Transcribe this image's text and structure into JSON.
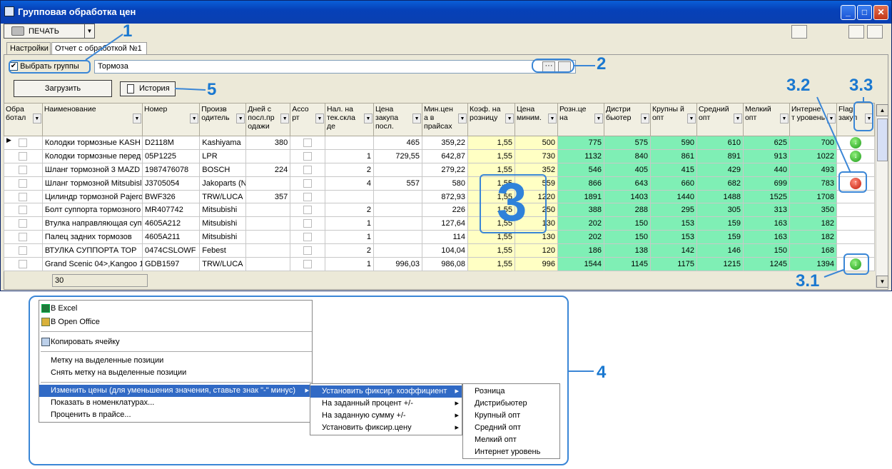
{
  "window": {
    "title": "Групповая обработка цен"
  },
  "toolbar": {
    "print_label": "ПЕЧАТЬ"
  },
  "tabs": [
    {
      "label": "Настройки"
    },
    {
      "label": "Отчет с обработкой №1"
    }
  ],
  "filter": {
    "select_groups_label": "Выбрать группы",
    "groups_value": "Тормоза",
    "dots": "···"
  },
  "buttons": {
    "load": "Загрузить",
    "history": "История"
  },
  "columns": [
    "Обра ботал",
    "Наименование",
    "Номер",
    "Произв одитель",
    "Дней с посл.пр одажи",
    "Ассо рт",
    "Нал. на тек.скла де",
    "Цена закупа посл.",
    "Мин.цен а в прайсах",
    "Коэф. на розницу",
    "Цена миним.",
    "Розн.це на",
    "Дистри бьютер",
    "Крупны й опт",
    "Средний опт",
    "Мелкий опт",
    "Интерне т уровень",
    "Flag закуп"
  ],
  "rows": [
    [
      "",
      "Колодки тормозные KASH",
      "D2118M",
      "Kashiyama",
      "380",
      "",
      "",
      "465",
      "359,22",
      "1,55",
      "500",
      "775",
      "575",
      "590",
      "610",
      "625",
      "700",
      "down"
    ],
    [
      "",
      "Колодки тормозные перед",
      "05P1225",
      "LPR",
      "",
      "",
      "1",
      "729,55",
      "642,87",
      "1,55",
      "730",
      "1132",
      "840",
      "861",
      "891",
      "913",
      "1022",
      "down"
    ],
    [
      "",
      "Шланг тормозной 3 MAZD",
      "1987476078",
      "BOSCH",
      "224",
      "",
      "2",
      "",
      "279,22",
      "1,55",
      "352",
      "546",
      "405",
      "415",
      "429",
      "440",
      "493",
      ""
    ],
    [
      "",
      "Шланг тормозной Mitsubisl",
      "J3705054",
      "Jakoparts (N",
      "",
      "",
      "4",
      "557",
      "580",
      "1,55",
      "559",
      "866",
      "643",
      "660",
      "682",
      "699",
      "783",
      "up"
    ],
    [
      "",
      "Цилиндр тормозной Pajero",
      "BWF326",
      "TRW/LUCA",
      "357",
      "",
      "",
      "",
      "872,93",
      "1,55",
      "1220",
      "1891",
      "1403",
      "1440",
      "1488",
      "1525",
      "1708",
      ""
    ],
    [
      "",
      "Болт суппорта тормозного",
      "MR407742",
      "Mitsubishi",
      "",
      "",
      "2",
      "",
      "226",
      "1,55",
      "250",
      "388",
      "288",
      "295",
      "305",
      "313",
      "350",
      ""
    ],
    [
      "",
      "Втулка направляющая суп",
      "4605A212",
      "Mitsubishi",
      "",
      "",
      "1",
      "",
      "127,64",
      "1,55",
      "130",
      "202",
      "150",
      "153",
      "159",
      "163",
      "182",
      ""
    ],
    [
      "",
      "Палец задних тормозов",
      "4605A211",
      "Mitsubishi",
      "",
      "",
      "1",
      "",
      "114",
      "1,55",
      "130",
      "202",
      "150",
      "153",
      "159",
      "163",
      "182",
      ""
    ],
    [
      "",
      "ВТУЛКА СУППОРТА ТОР",
      "0474CSLOWF",
      "Febest",
      "",
      "",
      "2",
      "",
      "104,04",
      "1,55",
      "120",
      "186",
      "138",
      "142",
      "146",
      "150",
      "168",
      ""
    ],
    [
      "",
      "Grand Scenic 04>,Kangoo 1",
      "GDB1597",
      "TRW/LUCA",
      "",
      "",
      "1",
      "996,03",
      "986,08",
      "1,55",
      "996",
      "1544",
      "1145",
      "1175",
      "1215",
      "1245",
      "1394",
      "down"
    ]
  ],
  "footer": {
    "count": "30"
  },
  "annotations": {
    "n1": "1",
    "n2": "2",
    "n3": "3",
    "n31": "3.1",
    "n32": "3.2",
    "n33": "3.3",
    "n4": "4",
    "n5": "5"
  },
  "context_menu": {
    "items": [
      "В Excel",
      "В Open Office",
      "Копировать ячейку",
      "Метку на выделенные позиции",
      "Снять метку на выделенные позиции",
      "Изменить цены (для уменьшения значения, ставьте знак \"-\" минус)",
      "Показать в номенклатурах...",
      "Проценить в прайсе..."
    ],
    "submenu": [
      "Установить фиксир. коэффициент",
      "На заданный процент +/-",
      "На заданную сумму +/-",
      "Установить фиксир.цену"
    ],
    "submenu2": [
      "Розница",
      "Дистрибьютер",
      "Крупный опт",
      "Средний опт",
      "Мелкий опт",
      "Интернет уровень"
    ]
  }
}
